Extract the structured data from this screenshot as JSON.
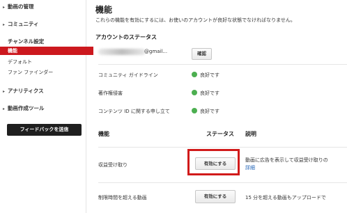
{
  "sidebar": {
    "groups": [
      {
        "label": "動画の管理"
      },
      {
        "label": "コミュニティ"
      },
      {
        "label": "チャンネル設定"
      },
      {
        "label": "アナリティクス"
      },
      {
        "label": "動画作成ツール"
      }
    ],
    "channel_items": [
      "機能",
      "デフォルト",
      "ファン ファインダー"
    ],
    "feedback_label": "フィードバックを送信"
  },
  "main": {
    "title": "機能",
    "subtitle": "これらの機能を有効にするには、お使いのアカウントが良好な状態でなければなりません。",
    "account_status_title": "アカウントのステータス",
    "email_domain": "@gmail...",
    "verify_label": "確認",
    "status_rows": [
      {
        "label": "コミュニティ ガイドライン",
        "status": "良好です"
      },
      {
        "label": "著作権侵害",
        "status": "良好です"
      },
      {
        "label": "コンテンツ ID に関する申し立て",
        "status": "良好です"
      }
    ],
    "columns": {
      "feature": "機能",
      "status": "ステータス",
      "description": "説明"
    },
    "features": [
      {
        "label": "収益受け取り",
        "button": "有効にする",
        "description": "動画に広告を表示して収益受け取りの",
        "link": "詳細"
      },
      {
        "label": "制限時間を超える動画",
        "button": "有効にする",
        "description": "15 分を超える動画もアップロードで"
      }
    ]
  },
  "colors": {
    "accent": "#cc181e",
    "status_ok": "#4caf50",
    "highlight_box": "#d11a1a",
    "link": "#1a5fb4"
  }
}
